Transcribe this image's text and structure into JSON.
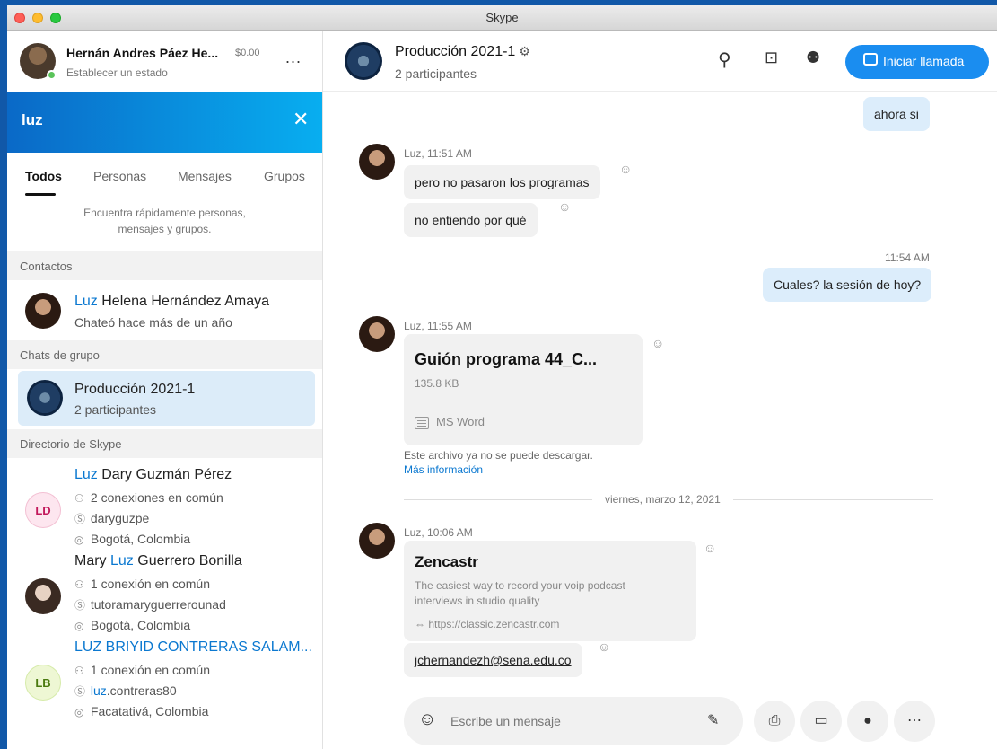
{
  "window": {
    "title": "Skype"
  },
  "profile": {
    "name": "Hernán Andres Páez He...",
    "credit": "$0.00",
    "status": "Establecer un estado",
    "more": "..."
  },
  "search": {
    "query": "luz",
    "close": "✕"
  },
  "tabs": [
    {
      "label": "Todos"
    },
    {
      "label": "Personas"
    },
    {
      "label": "Mensajes"
    },
    {
      "label": "Grupos"
    }
  ],
  "hint": "Encuentra rápidamente personas, mensajes y grupos.",
  "sections": {
    "contacts": "Contactos",
    "groups": "Chats de grupo",
    "directory": "Directorio de Skype"
  },
  "contact": {
    "name_hl": "Luz",
    "name_rest": " Helena Hernández Amaya",
    "sub": "Chateó hace más de un año"
  },
  "group": {
    "name": "Producción 2021-1",
    "sub": "2 participantes"
  },
  "directory": [
    {
      "initials": "LD",
      "pre": "",
      "hl": "Luz",
      "post": " Dary Guzmán Pérez",
      "conn": "2 conexiones en común",
      "user_hl": "",
      "user": "daryguzpe",
      "loc": "Bogotá, Colombia"
    },
    {
      "initials": "",
      "pre": "Mary ",
      "hl": "Luz",
      "post": " Guerrero Bonilla",
      "conn": "1 conexión en común",
      "user_hl": "",
      "user": "tutoramaryguerrerounad",
      "loc": "Bogotá, Colombia"
    },
    {
      "initials": "LB",
      "pre": "",
      "hl": "LUZ",
      "post": " BRIYID CONTRERAS SALAM...",
      "conn": "1 conexión en común",
      "user_hl": "luz",
      "user": ".contreras80",
      "loc": "Facatativá, Colombia"
    }
  ],
  "chat_header": {
    "title": "Producción 2021-1",
    "gear": "⚙",
    "subtitle": "2 participantes",
    "call_label": "Iniciar llamada"
  },
  "messages": {
    "m1": "ahora si",
    "meta1": "Luz, 11:51 AM",
    "m2": "pero no pasaron los programas",
    "m3": "no entiendo por qué",
    "time2": "11:54 AM",
    "m4": "Cuales? la sesión de hoy?",
    "meta2": "Luz, 11:55 AM",
    "file_name": "Guión programa 44_C...",
    "file_size": "135.8 KB",
    "file_type": "MS Word",
    "file_note": "Este archivo ya no se puede descargar.",
    "file_link": "Más información",
    "date_divider": "viernes, marzo 12, 2021",
    "meta3": "Luz, 10:06 AM",
    "card_title": "Zencastr",
    "card_desc": "The easiest way to record your voip podcast interviews in studio quality",
    "card_url": "https://classic.zencastr.com",
    "m5": "jchernandezh@sena.edu.co"
  },
  "composer": {
    "placeholder": "Escribe un mensaje"
  },
  "colors": {
    "accent": "#1a8df0",
    "highlight": "#0b78d0",
    "bubble_me": "#dcedfb",
    "bubble_them": "#f1f1f1"
  }
}
